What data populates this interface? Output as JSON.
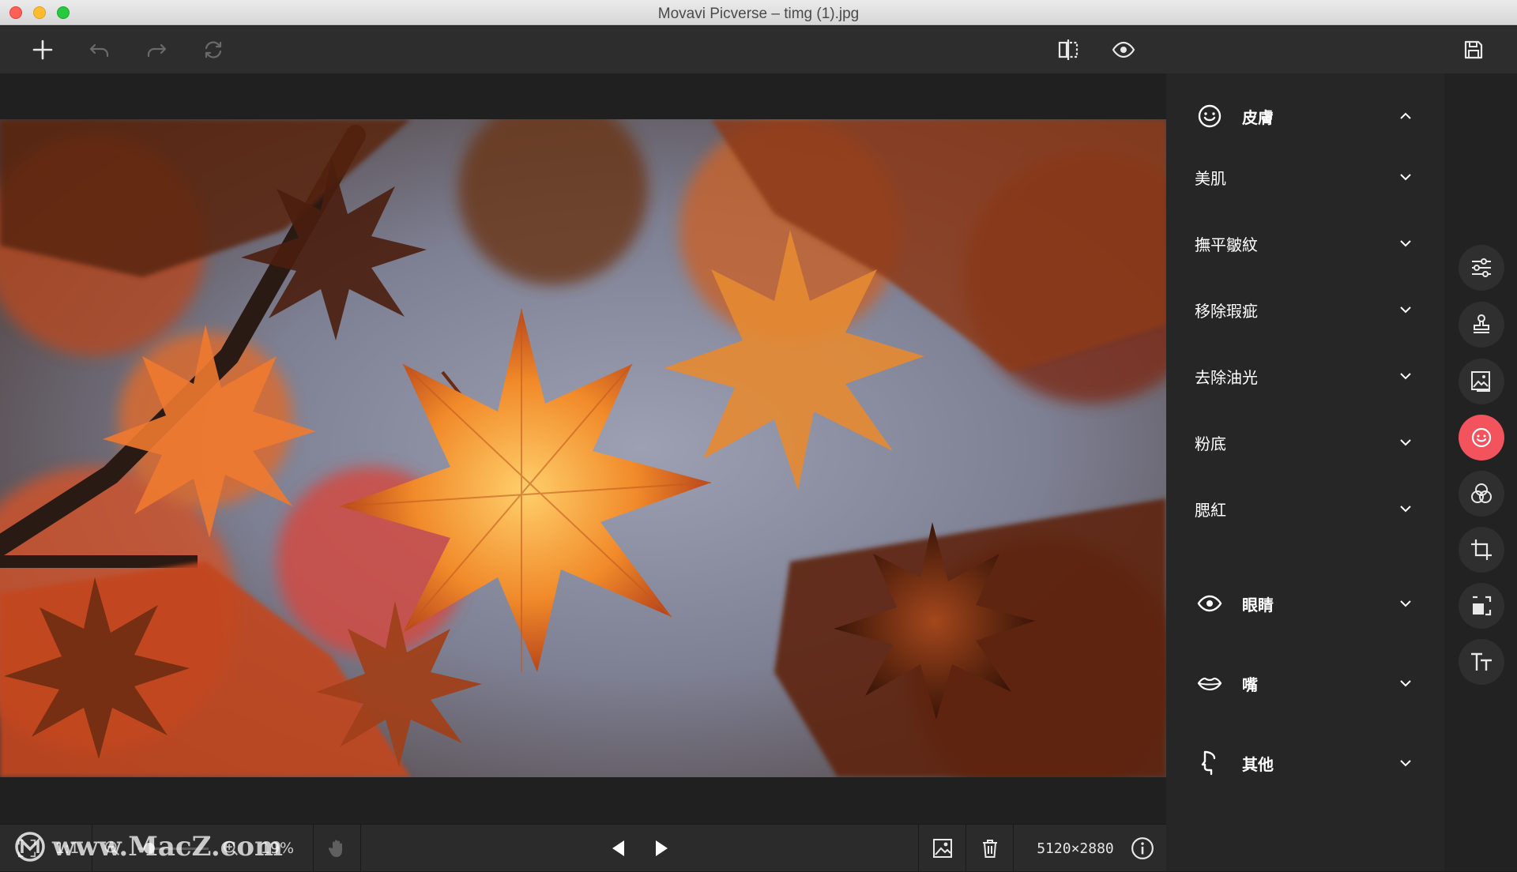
{
  "window": {
    "title": "Movavi Picverse – timg (1).jpg"
  },
  "toolbar": {
    "icons": [
      "add-icon",
      "undo-icon",
      "redo-icon",
      "reset-icon",
      "compare-icon",
      "preview-eye-icon",
      "save-icon"
    ]
  },
  "panel": {
    "skin": {
      "label": "皮膚",
      "items": [
        {
          "label": "美肌"
        },
        {
          "label": "撫平皺紋"
        },
        {
          "label": "移除瑕疵"
        },
        {
          "label": "去除油光"
        },
        {
          "label": "粉底"
        },
        {
          "label": "腮紅"
        }
      ]
    },
    "eyes": {
      "label": "眼睛"
    },
    "mouth": {
      "label": "嘴"
    },
    "other": {
      "label": "其他"
    }
  },
  "rail": {
    "icons": [
      "adjust-sliders-icon",
      "stamp-icon",
      "replace-background-icon",
      "retouch-face-icon",
      "filters-icon",
      "crop-icon",
      "resize-icon",
      "text-icon"
    ],
    "active": "retouch-face-icon"
  },
  "bottombar": {
    "zoom_fit": "1:1",
    "zoom_level": "19%",
    "resolution": "5120×2880"
  },
  "watermark": {
    "text": "www.MacZ.com"
  },
  "colors": {
    "accent": "#f2535d",
    "toolbar": "#2d2d2d",
    "panel": "#262626"
  }
}
